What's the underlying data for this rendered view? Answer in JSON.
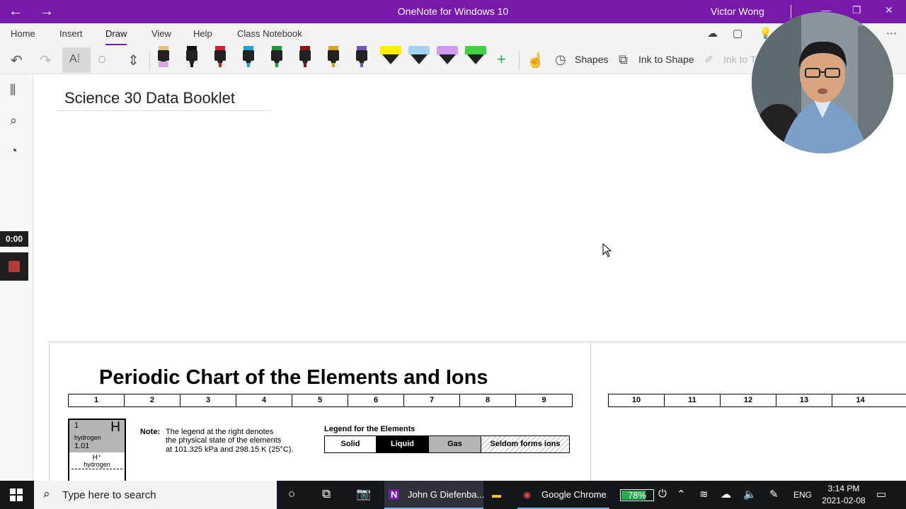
{
  "window": {
    "title": "OneNote for Windows 10",
    "user": "Victor Wong",
    "back_icon": "arrow-left-icon",
    "forward_icon": "arrow-right-icon"
  },
  "ribbon": {
    "tabs": [
      "Home",
      "Insert",
      "Draw",
      "View",
      "Help",
      "Class Notebook"
    ],
    "active_tab": "Draw",
    "accent_color": "#7719aa"
  },
  "toolbar": {
    "shapes_label": "Shapes",
    "ink_to_shape_label": "Ink to Shape",
    "ink_to_text_label": "Ink to T",
    "pens": [
      "#111111",
      "#d81e2a",
      "#1aa3d8",
      "#1f9a3b",
      "#8a1616",
      "#d9a21a",
      "#7a4fc1"
    ],
    "highlighters": [
      "#ffee00",
      "#9fd4f7",
      "#cf9cf2",
      "#3fd43f"
    ]
  },
  "rail": {
    "timer": "0:00"
  },
  "page": {
    "title": "Science 30 Data Booklet"
  },
  "printout": {
    "title": "Periodic Chart of the Elements and Ions",
    "groups_left": [
      "1",
      "2",
      "3",
      "4",
      "5",
      "6",
      "7",
      "8",
      "9"
    ],
    "groups_right": [
      "10",
      "11",
      "12",
      "13",
      "14"
    ],
    "hydrogen": {
      "number": "1",
      "symbol": "H",
      "name": "hydrogen",
      "mass": "1.01",
      "ion": "H⁺",
      "ion_name": "hydrogen"
    },
    "note_label": "Note:",
    "note_lines": [
      "The legend at the right denotes",
      "the physical state of the elements",
      "at 101.325 kPa and 298.15 K (25°C)."
    ],
    "legend_title": "Legend for the Elements",
    "legend": [
      "Solid",
      "Liquid",
      "Gas",
      "Seldom forms ions"
    ]
  },
  "taskbar": {
    "search_placeholder": "Type here to search",
    "onenote_label": "John G Diefenba...",
    "chrome_label": "Google Chrome",
    "battery_percent": 78,
    "battery_text": "78%",
    "language": "ENG",
    "time": "3:14 PM",
    "date": "2021-02-08"
  }
}
